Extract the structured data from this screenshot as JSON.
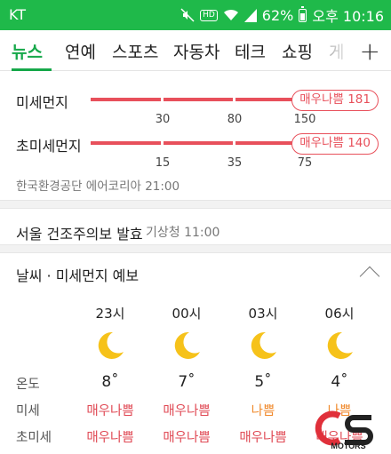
{
  "status": {
    "carrier": "KT",
    "battery": "62%",
    "time": "오후 10:16",
    "hd": "HD",
    "colors": {
      "bar": "#1fb94a"
    }
  },
  "tabs": [
    {
      "label": "뉴스",
      "active": true
    },
    {
      "label": "연예"
    },
    {
      "label": "스포츠"
    },
    {
      "label": "자동차"
    },
    {
      "label": "테크"
    },
    {
      "label": "쇼핑"
    },
    {
      "label": "게"
    }
  ],
  "tabs_more_icon": "plus-icon",
  "dust": {
    "pm10": {
      "label": "미세먼지",
      "grade": "매우나쁨",
      "value": "181",
      "ticks": [
        "30",
        "80",
        "150"
      ]
    },
    "pm25": {
      "label": "초미세먼지",
      "grade": "매우나쁨",
      "value": "140",
      "ticks": [
        "15",
        "35",
        "75"
      ]
    },
    "source": "한국환경공단 에어코리아 21:00",
    "colors": {
      "very_bad": "#e8505b",
      "bad": "#f08a2d"
    }
  },
  "alert": {
    "text": "서울 건조주의보 발효",
    "source": "기상청 11:00"
  },
  "forecast": {
    "title": "날씨 · 미세먼지 예보",
    "row_labels": {
      "temp": "온도",
      "pm10": "미세",
      "pm25": "초미세"
    },
    "hours": [
      {
        "time": "23시",
        "icon": "moon-icon",
        "temp": "8˚",
        "pm10": "매우나쁨",
        "pm10_level": "bad",
        "pm25": "매우나쁨",
        "pm25_level": "bad"
      },
      {
        "time": "00시",
        "icon": "moon-icon",
        "temp": "7˚",
        "pm10": "매우나쁨",
        "pm10_level": "bad",
        "pm25": "매우나쁨",
        "pm25_level": "bad"
      },
      {
        "time": "03시",
        "icon": "moon-icon",
        "temp": "5˚",
        "pm10": "나쁨",
        "pm10_level": "mid",
        "pm25": "매우나쁨",
        "pm25_level": "bad"
      },
      {
        "time": "06시",
        "icon": "moon-icon",
        "temp": "4˚",
        "pm10": "나쁨",
        "pm10_level": "mid",
        "pm25": "매우나쁨",
        "pm25_level": "bad"
      }
    ]
  },
  "watermark": {
    "text": "MOTORS"
  }
}
